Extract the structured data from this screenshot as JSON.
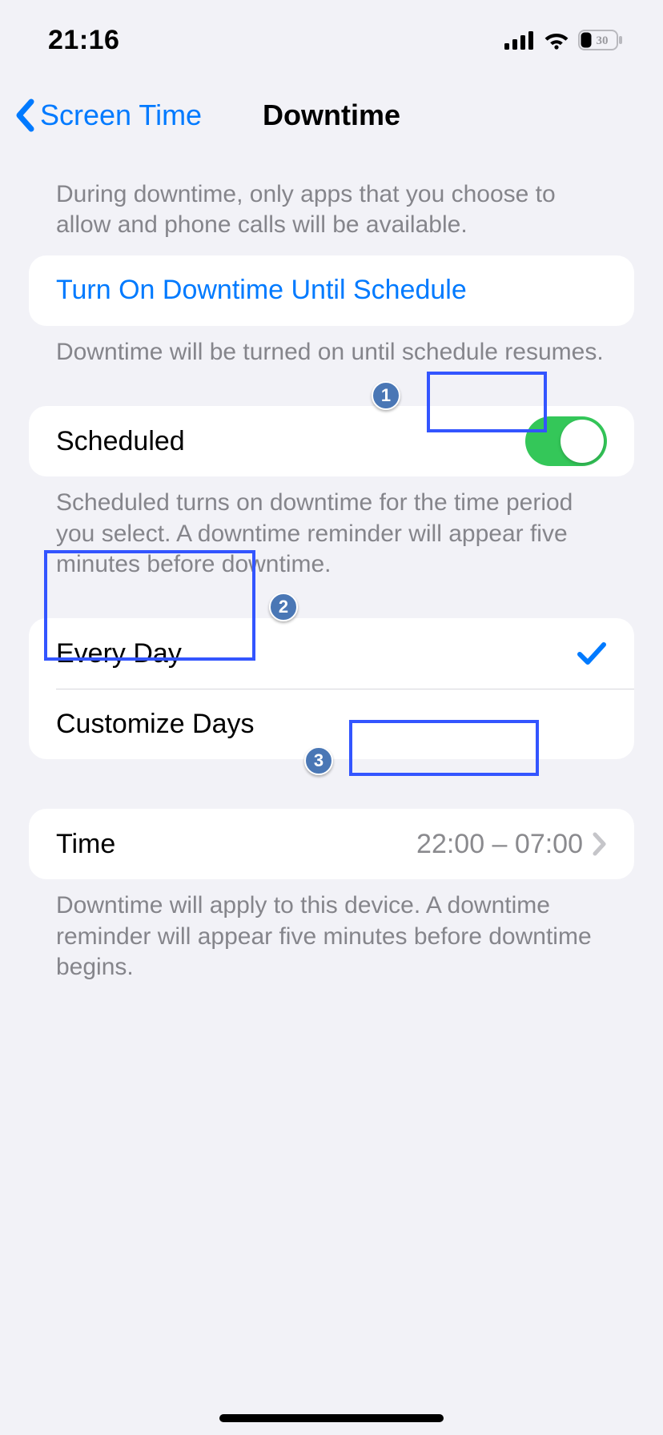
{
  "status": {
    "time": "21:16",
    "battery": "30"
  },
  "nav": {
    "back_label": "Screen Time",
    "title": "Downtime"
  },
  "intro": "During downtime, only apps that you choose to allow and phone calls will be available.",
  "turn_on": {
    "label": "Turn On Downtime Until Schedule",
    "footer": "Downtime will be turned on until schedule resumes."
  },
  "scheduled": {
    "label": "Scheduled",
    "on": true,
    "footer": "Scheduled turns on downtime for the time period you select. A downtime reminder will appear five minutes before downtime."
  },
  "schedule_mode": {
    "every_day_label": "Every Day",
    "customize_label": "Customize Days",
    "selected": "every_day"
  },
  "time_row": {
    "label": "Time",
    "value": "22:00 – 07:00"
  },
  "time_footer": "Downtime will apply to this device. A downtime reminder will appear five minutes before downtime begins.",
  "callouts": {
    "1": "1",
    "2": "2",
    "3": "3"
  }
}
